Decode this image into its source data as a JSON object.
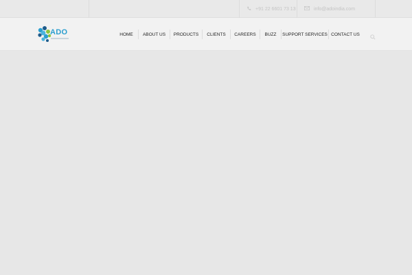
{
  "topbar": {
    "phone": "+91 22 6601 73 13",
    "email": "info@adoindia.com",
    "phone_icon": "phone-icon",
    "email_icon": "envelope-icon"
  },
  "logo": {
    "text": "ADO",
    "colors": [
      "#2b9fcf",
      "#8cc63f",
      "#1d5c8c",
      "#4bb3dd"
    ]
  },
  "nav": {
    "items": [
      {
        "label": "HOME"
      },
      {
        "label": "ABOUT US"
      },
      {
        "label": "PRODUCTS"
      },
      {
        "label": "CLIENTS"
      },
      {
        "label": "CAREERS"
      },
      {
        "label": "BUZZ"
      },
      {
        "label": "SUPPORT SERVICES"
      },
      {
        "label": "CONTACT US"
      }
    ],
    "search_icon": "search-icon"
  }
}
